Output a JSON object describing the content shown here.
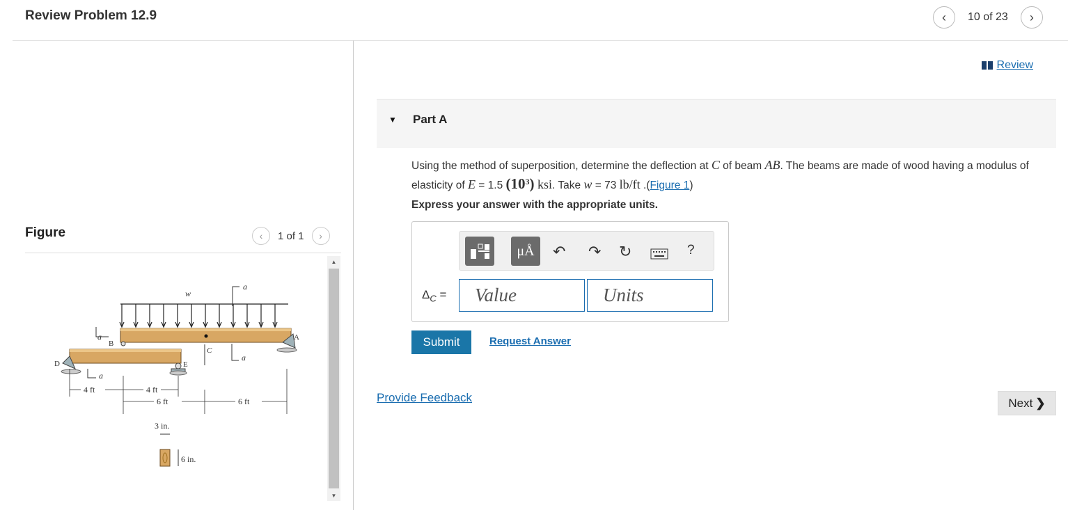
{
  "header": {
    "title": "Review Problem 12.9",
    "page": "10 of 23"
  },
  "figure": {
    "label": "Figure",
    "page": "1 of 1",
    "labels": {
      "w": "w",
      "a": "a",
      "B": "B",
      "A": "A",
      "C": "C",
      "D": "D",
      "E": "E",
      "d1": "4 ft",
      "d2": "4 ft",
      "d3": "6 ft",
      "d4": "6 ft",
      "width": "3 in.",
      "height": "6 in."
    }
  },
  "review": {
    "label": "Review"
  },
  "part": {
    "title": "Part A"
  },
  "question": {
    "t1": "Using the method of superposition, determine the deflection at ",
    "C": "C",
    "t2": " of beam ",
    "AB": "AB",
    "t3": ". The beams are made of wood having a modulus of elasticity of ",
    "E": "E",
    "t4": " = 1.5 ",
    "pow": "(10",
    "exp": "3",
    "pclose": ")",
    "ksi": " ksi",
    "t5": ". Take ",
    "w": "w",
    "t6": " = 73 ",
    "unit": "lb/ft",
    "t7": " .(",
    "figlink": "Figure 1",
    "t8": ")"
  },
  "instruction": "Express your answer with the appropriate units.",
  "answer": {
    "label": "Δ",
    "label_sub": "C",
    "label_eq": " =",
    "value_placeholder": "Value",
    "units_placeholder": "Units",
    "toolbar": {
      "units_glyph": "μÅ",
      "help": "?"
    }
  },
  "buttons": {
    "submit": "Submit",
    "request": "Request Answer",
    "next": "Next"
  },
  "feedback": "Provide Feedback"
}
